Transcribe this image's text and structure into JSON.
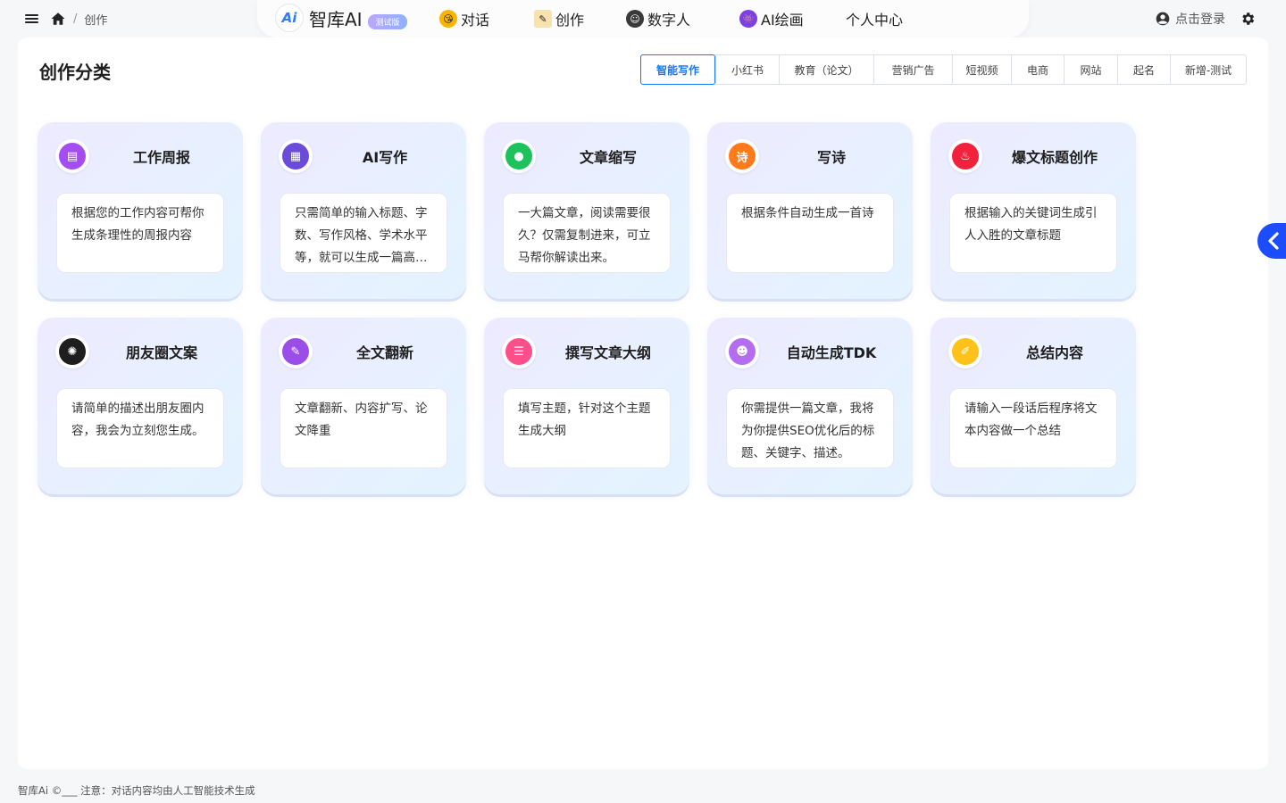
{
  "breadcrumb": {
    "separator": "/",
    "current": "创作"
  },
  "brand": {
    "logo_text": "Ai",
    "name": "智库AI",
    "badge": "测试版"
  },
  "nav": [
    {
      "label": "对话",
      "icon": "smile-emoji-icon",
      "color": "#f7b500"
    },
    {
      "label": "创作",
      "icon": "memo-pencil-icon",
      "color": "#f1c36a"
    },
    {
      "label": "数字人",
      "icon": "avatar-face-icon",
      "color": "#3a3a3a"
    },
    {
      "label": "AI绘画",
      "icon": "alien-monster-icon",
      "color": "#7b3fe4"
    },
    {
      "label": "个人中心",
      "icon": "",
      "color": ""
    }
  ],
  "header_right": {
    "login_label": "点击登录"
  },
  "panel": {
    "title": "创作分类"
  },
  "tabs": [
    {
      "label": "智能写作",
      "active": true
    },
    {
      "label": "小红书",
      "active": false
    },
    {
      "label": "教育（论文）",
      "active": false
    },
    {
      "label": "营销广告",
      "active": false
    },
    {
      "label": "短视频",
      "active": false
    },
    {
      "label": "电商",
      "active": false
    },
    {
      "label": "网站",
      "active": false
    },
    {
      "label": "起名",
      "active": false
    },
    {
      "label": "新增-测试",
      "active": false
    }
  ],
  "cards": [
    {
      "title": "工作周报",
      "desc": "根据您的工作内容可帮你生成条理性的周报内容",
      "icon": "document-report-icon",
      "color": "#a44df0",
      "glyph": "▤"
    },
    {
      "title": "AI写作",
      "desc": "只需简单的输入标题、字数、写作风格、学术水平等，就可以生成一篇高质量的文章",
      "icon": "ai-document-icon",
      "color": "#6b4bd9",
      "glyph": "▦"
    },
    {
      "title": "文章缩写",
      "desc": "一大篇文章，阅读需要很久？仅需复制进来，可立马帮你解读出来。",
      "icon": "chat-bubble-icon",
      "color": "#1ec25c",
      "glyph": "●"
    },
    {
      "title": "写诗",
      "desc": "根据条件自动生成一首诗",
      "icon": "poem-icon",
      "color": "#ff7a1a",
      "glyph": "诗"
    },
    {
      "title": "爆文标题创作",
      "desc": "根据输入的关键词生成引人入胜的文章标题",
      "icon": "flame-icon",
      "color": "#f2213c",
      "glyph": "♨"
    },
    {
      "title": "朋友圈文案",
      "desc": "请简单的描述出朋友圈内容，我会为立刻您生成。",
      "icon": "aperture-icon",
      "color": "#1e1e1e",
      "glyph": "✺"
    },
    {
      "title": "全文翻新",
      "desc": "文章翻新、内容扩写、论文降重",
      "icon": "edit-note-icon",
      "color": "#9b4dea",
      "glyph": "✎"
    },
    {
      "title": "撰写文章大纲",
      "desc": "填写主题，针对这个主题生成大纲",
      "icon": "outline-list-icon",
      "color": "#ff4f8b",
      "glyph": "☰"
    },
    {
      "title": "自动生成TDK",
      "desc": "你需提供一篇文章，我将为你提供SEO优化后的标题、关键字、描述。",
      "icon": "robot-icon",
      "color": "#b46cf0",
      "glyph": "☻"
    },
    {
      "title": "总结内容",
      "desc": "请输入一段话后程序将文本内容做一个总结",
      "icon": "summary-note-icon",
      "color": "#ffc21a",
      "glyph": "✐"
    }
  ],
  "footer": {
    "text": "智库Ai ©___ 注意：对话内容均由人工智能技术生成"
  }
}
